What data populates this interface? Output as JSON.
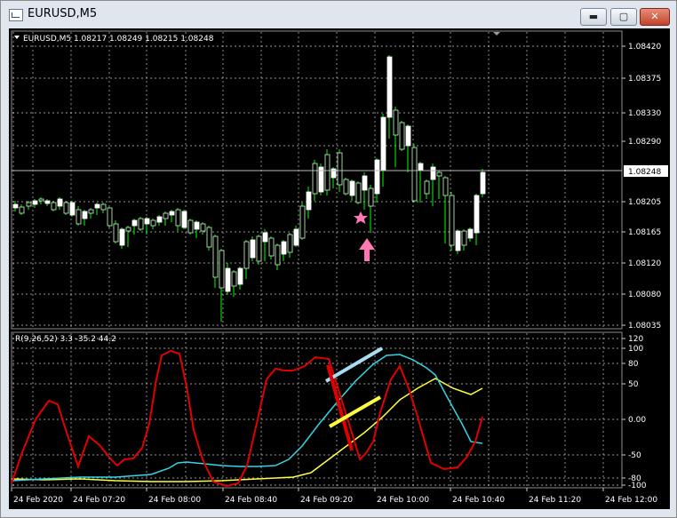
{
  "window": {
    "title": "EURUSD,M5"
  },
  "price_chart": {
    "info": "EURUSD,M5  1.08217 1.08249 1.08215 1.08248",
    "current_price": "1.08248",
    "price_labels": [
      "1.08420",
      "1.08375",
      "1.08330",
      "1.08290",
      "1.08205",
      "1.08165",
      "1.08120",
      "1.08080",
      "1.08035"
    ]
  },
  "indicator": {
    "info": "R(9,26,52) 3.3 -35.2 44.2",
    "scale_labels": [
      "120",
      "100",
      "80",
      "50",
      "0.00",
      "-50",
      "-80",
      "-100"
    ]
  },
  "time_axis": [
    "24 Feb 2020",
    "24 Feb 07:20",
    "24 Feb 08:00",
    "24 Feb 08:40",
    "24 Feb 09:20",
    "24 Feb 10:00",
    "24 Feb 10:40",
    "24 Feb 11:20",
    "24 Feb 12:00"
  ],
  "colors": {
    "bull": "#c8ffc8",
    "bear": "#ffffff",
    "wick": "#00ff00",
    "grid": "#c8c8c8",
    "red_line": "#e00000",
    "cyan_line": "#31d7e6",
    "yellow_line": "#ffff3c",
    "star": "#ff78b4",
    "arrow": "#ff78b4"
  },
  "icons": {
    "minimize": "minimize-icon",
    "maximize": "maximize-icon",
    "close": "close-icon",
    "star": "star-icon",
    "arrow": "up-arrow-icon"
  },
  "window_buttons": {
    "minimize": "▬",
    "maximize": "▢",
    "close": "✕"
  }
}
